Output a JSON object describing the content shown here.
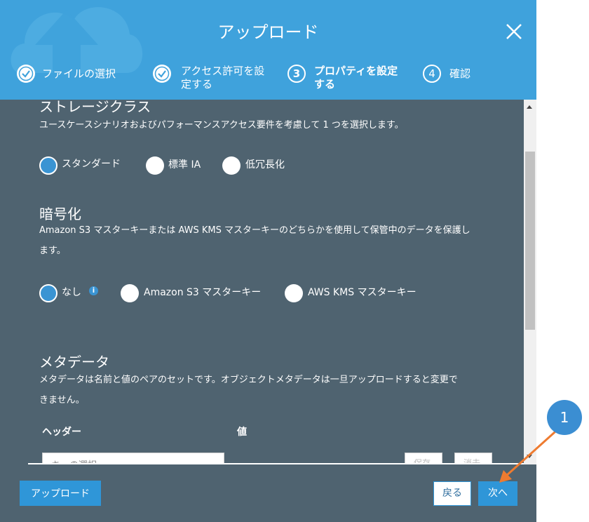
{
  "dialog": {
    "title": "アップロード",
    "steps": [
      {
        "label_line1": "ファイルの選択",
        "label_line2": "",
        "state": "done"
      },
      {
        "label_line1": "アクセス許可を設",
        "label_line2": "定する",
        "state": "done"
      },
      {
        "number": "3",
        "label_line1": "プロパティを設定",
        "label_line2": "する",
        "state": "current"
      },
      {
        "number": "4",
        "label_line1": "確認",
        "label_line2": "",
        "state": "pending"
      }
    ]
  },
  "storage": {
    "heading": "ストレージクラス",
    "description": "ユースケースシナリオおよびパフォーマンスアクセス要件を考慮して 1 つを選択します。",
    "options": [
      "スタンダード",
      "標準 IA",
      "低冗長化"
    ],
    "selected": "スタンダード"
  },
  "encryption": {
    "heading": "暗号化",
    "description_line1": "Amazon S3 マスターキーまたは AWS KMS マスターキーのどちらかを使用して保管中のデータを保護し",
    "description_line2": "ます。",
    "options": [
      "なし",
      "Amazon S3 マスターキー",
      "AWS KMS マスターキー"
    ],
    "selected": "なし",
    "info_icon": "i"
  },
  "metadata": {
    "heading": "メタデータ",
    "description_line1": "メタデータは名前と値のペアのセットです。オブジェクトメタデータは一旦アップロードすると変更で",
    "description_line2": "きません。",
    "col_header": "ヘッダー",
    "col_value": "値",
    "key_placeholder": "キーの選択",
    "save_label": "保存",
    "clear_label": "消去"
  },
  "footer": {
    "upload_label": "アップロード",
    "back_label": "戻る",
    "next_label": "次へ"
  },
  "annotation": {
    "badge": "1",
    "color": "#ee7b30"
  },
  "colors": {
    "header": "#3fa2dc",
    "body": "#4f6370",
    "primary": "#2f96d8"
  }
}
